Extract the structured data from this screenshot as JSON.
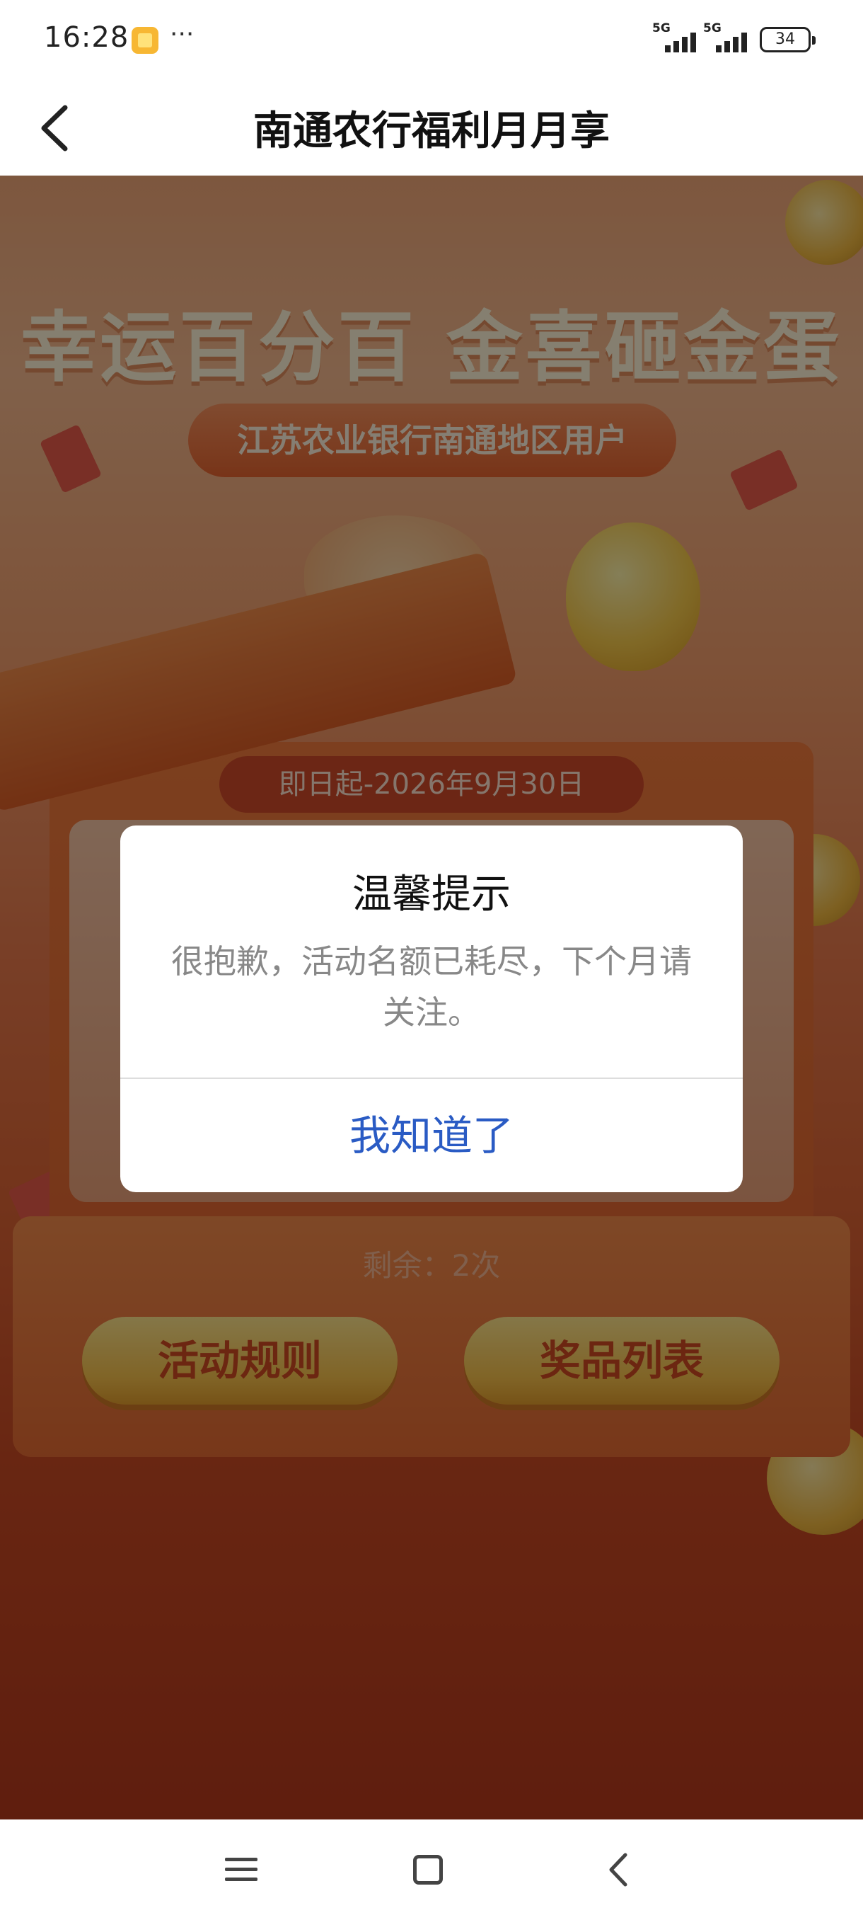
{
  "status_bar": {
    "time": "16:28",
    "dots": "···",
    "signal1_label": "5G",
    "signal2_label": "5G",
    "battery": "34"
  },
  "nav": {
    "title": "南通农行福利月月享"
  },
  "background": {
    "hero_title": "幸运百分百 金喜砸金蛋",
    "hero_subtitle": "江苏农业银行南通地区用户",
    "date_range": "即日起-2026年9月30日",
    "remaining": "剩余：2次",
    "rules_button": "活动规则",
    "prizes_button": "奖品列表"
  },
  "dialog": {
    "title": "温馨提示",
    "message": "很抱歉，活动名额已耗尽，下个月请关注。",
    "confirm_button": "我知道了"
  },
  "colors": {
    "accent_blue": "#2a5bc4",
    "background_orange": "#e8784a",
    "button_gold": "#f6c04a"
  }
}
